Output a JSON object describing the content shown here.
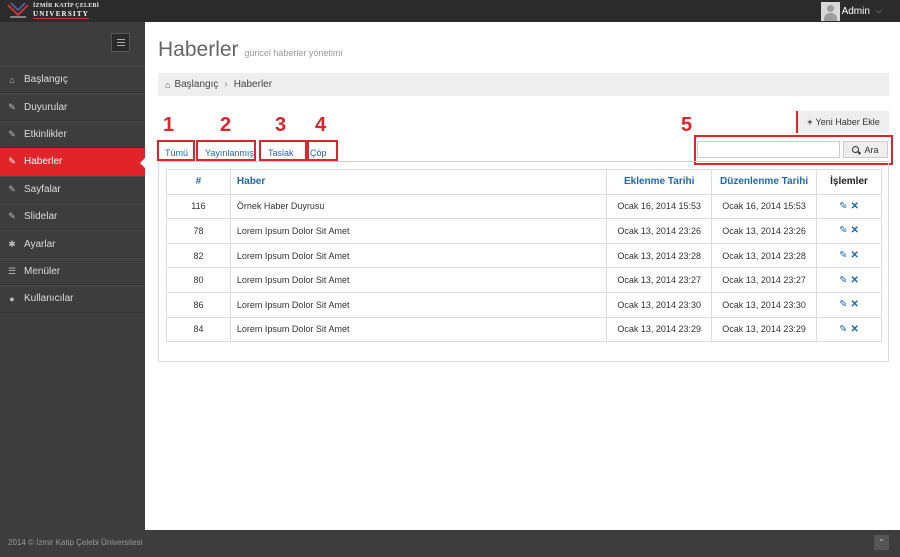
{
  "topbar": {
    "logo_line1": "İZMİR KATİP ÇELEBİ",
    "logo_line2": "UNIVERSITY",
    "user_name": "Admin"
  },
  "sidebar": {
    "items": [
      {
        "label": "Başlangıç",
        "icon": "home-icon"
      },
      {
        "label": "Duyurular",
        "icon": "edit-icon"
      },
      {
        "label": "Etkinlikler",
        "icon": "edit-icon"
      },
      {
        "label": "Haberler",
        "icon": "edit-icon",
        "active": true
      },
      {
        "label": "Sayfalar",
        "icon": "edit-icon"
      },
      {
        "label": "Slidelar",
        "icon": "edit-icon"
      },
      {
        "label": "Ayarlar",
        "icon": "gear-icon"
      },
      {
        "label": "Menüler",
        "icon": "list-icon"
      },
      {
        "label": "Kullanıcılar",
        "icon": "user-icon"
      }
    ]
  },
  "page": {
    "title": "Haberler",
    "subtitle": "güncel haberler yönetimi"
  },
  "breadcrumb": {
    "home": "Başlangıç",
    "current": "Haberler"
  },
  "actions": {
    "new_label": "Yeni Haber Ekle",
    "search_button": "Ara",
    "search_value": ""
  },
  "filters": [
    "Tümü",
    "Yayınlanmış",
    "Taslak",
    "Çöp"
  ],
  "annotations": [
    "1",
    "2",
    "3",
    "4",
    "5"
  ],
  "table": {
    "headers": [
      "#",
      "Haber",
      "Eklenme Tarihi",
      "Düzenlenme Tarihi",
      "İşlemler"
    ],
    "rows": [
      {
        "id": "116",
        "title": "Örnek Haber Duyrusu",
        "created": "Ocak 16, 2014 15:53",
        "updated": "Ocak 16, 2014 15:53"
      },
      {
        "id": "78",
        "title": "Lorem Ipsum Dolor Sit Amet",
        "created": "Ocak 13, 2014 23:26",
        "updated": "Ocak 13, 2014 23:26"
      },
      {
        "id": "82",
        "title": "Lorem Ipsum Dolor Sit Amet",
        "created": "Ocak 13, 2014 23:28",
        "updated": "Ocak 13, 2014 23:28"
      },
      {
        "id": "80",
        "title": "Lorem Ipsum Dolor Sit Amet",
        "created": "Ocak 13, 2014 23:27",
        "updated": "Ocak 13, 2014 23:27"
      },
      {
        "id": "86",
        "title": "Lorem Ipsum Dolor Sit Amet",
        "created": "Ocak 13, 2014 23:30",
        "updated": "Ocak 13, 2014 23:30"
      },
      {
        "id": "84",
        "title": "Lorem Ipsum Dolor Sit Amet",
        "created": "Ocak 13, 2014 23:29",
        "updated": "Ocak 13, 2014 23:29"
      }
    ]
  },
  "footer": {
    "copyright": "2014 © İzmir Katip Çelebi Üniversitesi"
  },
  "colors": {
    "accent": "#e0242a",
    "link": "#1c6ab2",
    "sidebar": "#3d3d3d"
  }
}
